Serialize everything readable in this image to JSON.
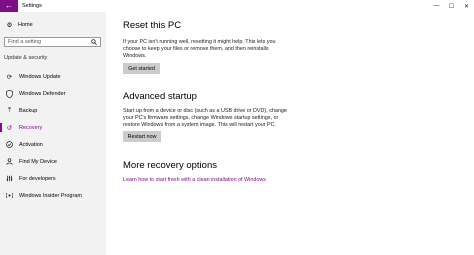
{
  "window": {
    "title": "Settings",
    "back_glyph": "←",
    "controls": {
      "minimize": "—",
      "maximize": "☐",
      "close": "✕"
    }
  },
  "sidebar": {
    "home": {
      "label": "Home",
      "icon": "gear-icon"
    },
    "search": {
      "placeholder": "Find a setting",
      "icon": "search-icon"
    },
    "section_label": "Update & security",
    "items": [
      {
        "label": "Windows Update",
        "icon": "refresh-icon"
      },
      {
        "label": "Windows Defender",
        "icon": "shield-icon"
      },
      {
        "label": "Backup",
        "icon": "backup-icon"
      },
      {
        "label": "Recovery",
        "icon": "recovery-icon",
        "selected": true
      },
      {
        "label": "Activation",
        "icon": "check-circle-icon"
      },
      {
        "label": "Find My Device",
        "icon": "person-icon"
      },
      {
        "label": "For developers",
        "icon": "developer-icon"
      },
      {
        "label": "Windows Insider Program",
        "icon": "insider-icon"
      }
    ]
  },
  "main": {
    "reset": {
      "heading": "Reset this PC",
      "description": "If your PC isn't running well, resetting it might help. This lets you choose to keep your files or remove them, and then reinstalls Windows.",
      "button": "Get started"
    },
    "advanced": {
      "heading": "Advanced startup",
      "description": "Start up from a device or disc (such as a USB drive or DVD), change your PC's firmware settings, change Windows startup settings, or restore Windows from a system image. This will restart your PC.",
      "button": "Restart now"
    },
    "more": {
      "heading": "More recovery options",
      "link": "Learn how to start fresh with a clean installation of Windows"
    }
  },
  "colors": {
    "accent": "#7a0f86",
    "sidebar_bg": "#f2f2f2",
    "button_bg": "#cccccc"
  }
}
